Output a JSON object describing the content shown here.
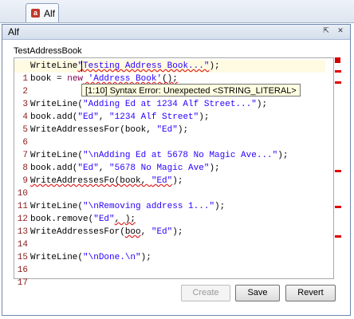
{
  "tab": {
    "icon": "alf-icon",
    "label": "Alf"
  },
  "panel": {
    "title": "Alf",
    "section_label": "TestAddressBook"
  },
  "editor": {
    "lines": [
      {
        "n": "1"
      },
      {
        "n": "2"
      },
      {
        "n": "3"
      },
      {
        "n": "4"
      },
      {
        "n": "5"
      },
      {
        "n": "6"
      },
      {
        "n": "7"
      },
      {
        "n": "8"
      },
      {
        "n": "9"
      },
      {
        "n": "10"
      },
      {
        "n": "11"
      },
      {
        "n": "12"
      },
      {
        "n": "13"
      },
      {
        "n": "14"
      },
      {
        "n": "15"
      },
      {
        "n": "16"
      },
      {
        "n": "17"
      }
    ],
    "code": {
      "l1_a": "WriteLine",
      "l1_b": "\"Testing Address Book...\"",
      "l1_c": ");",
      "l2_a": "book = ",
      "l2_b": "new",
      "l2_c": " 'Address Book'",
      "l2_d": "();",
      "l4_a": "WriteLine(",
      "l4_b": "\"Adding Ed at 1234 Alf Street...\"",
      "l4_c": ");",
      "l5_a": "book.add(",
      "l5_b": "\"Ed\"",
      "l5_c": ", ",
      "l5_d": "\"1234 Alf Street\"",
      "l5_e": ");",
      "l6_a": "WriteAddressesFor(book, ",
      "l6_b": "\"Ed\"",
      "l6_c": ");",
      "l8_a": "WriteLine(",
      "l8_b": "\"\\nAdding Ed at 5678 No Magic Ave...\"",
      "l8_c": ");",
      "l9_a": "book.add(",
      "l9_b": "\"Ed\"",
      "l9_c": ", ",
      "l9_d": "\"5678 No Magic Ave\"",
      "l9_e": ");",
      "l10_a": "WriteAddressesFo",
      "l10_b": "(book, ",
      "l10_c": "\"Ed\"",
      "l10_d": ");",
      "l12_a": "WriteLine(",
      "l12_b": "\"\\nRemoving address 1...\"",
      "l12_c": ");",
      "l13_a": "book.remove(",
      "l13_b": "\"Ed\"",
      "l13_c": ", ",
      "l13_d": ");",
      "l14_a": "WriteAddressesFor(",
      "l14_b": "boo",
      "l14_c": ", ",
      "l14_d": "\"Ed\"",
      "l14_e": ");",
      "l16_a": "WriteLine(",
      "l16_b": "\"\\nDone.\\n\"",
      "l16_c": ");"
    },
    "tooltip": "[1:10] Syntax Error: Unexpected <STRING_LITERAL>"
  },
  "buttons": {
    "create": "Create",
    "save": "Save",
    "revert": "Revert"
  },
  "colors": {
    "string": "#2a00ff",
    "keyword": "#7f0055",
    "error": "#e00000",
    "line_number": "#8b1a1a"
  }
}
